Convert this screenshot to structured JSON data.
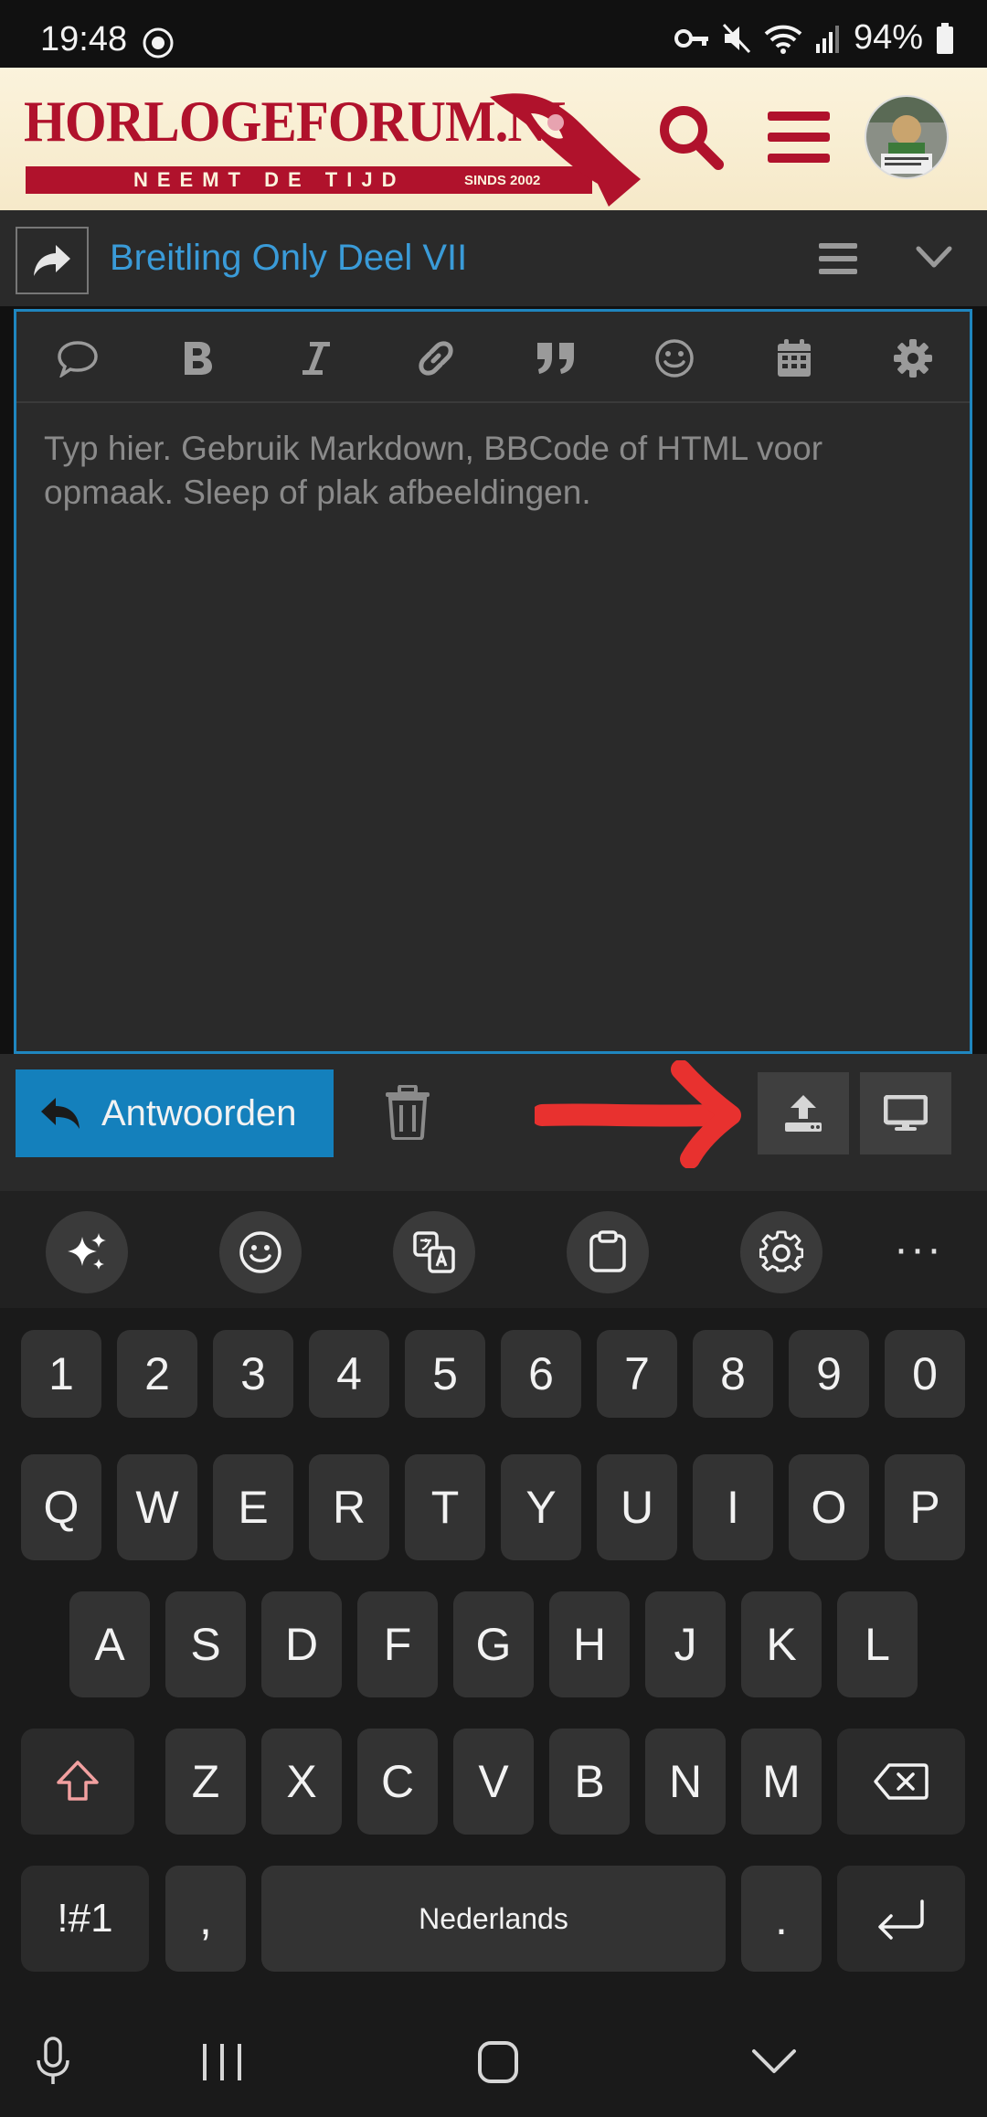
{
  "status_bar": {
    "time": "19:48",
    "battery": "94%",
    "icons": [
      "app-notification-icon",
      "vpn-key-icon",
      "mute-icon",
      "wifi-icon",
      "signal-icon",
      "battery-icon"
    ]
  },
  "header": {
    "logo_text": "HORLOGEFORUM.NL",
    "logo_tagline": "NEEMT DE TIJD",
    "logo_since": "SINDS 2002",
    "brand_color": "#b0122c",
    "icons": [
      "search-icon",
      "hamburger-menu-icon",
      "avatar"
    ]
  },
  "thread": {
    "title": "Breitling Only Deel VII"
  },
  "editor": {
    "placeholder": "Typ hier. Gebruik Markdown, BBCode of HTML voor opmaak. Sleep of plak afbeeldingen.",
    "border_color": "#1f86bf",
    "toolbar_icons": [
      "speech-bubble-icon",
      "bold-icon",
      "italic-icon",
      "link-icon",
      "quote-icon",
      "emoji-icon",
      "calendar-icon",
      "gear-icon"
    ]
  },
  "actions": {
    "reply_label": "Antwoorden",
    "accent": "#1480bc",
    "icons": [
      "reply-icon",
      "trash-icon",
      "upload-icon",
      "preview-icon"
    ]
  },
  "keyboard": {
    "toolbar_icons": [
      "sparkle-icon",
      "emoji-icon",
      "translate-icon",
      "clipboard-icon",
      "settings-icon",
      "more-icon"
    ],
    "number_row": [
      "1",
      "2",
      "3",
      "4",
      "5",
      "6",
      "7",
      "8",
      "9",
      "0"
    ],
    "row1": [
      "Q",
      "W",
      "E",
      "R",
      "T",
      "Y",
      "U",
      "I",
      "O",
      "P"
    ],
    "row2": [
      "A",
      "S",
      "D",
      "F",
      "G",
      "H",
      "J",
      "K",
      "L"
    ],
    "row3": [
      "Z",
      "X",
      "C",
      "V",
      "B",
      "N",
      "M"
    ],
    "symbols_label": "!#1",
    "comma_label": ",",
    "space_label": "Nederlands",
    "period_label": ".",
    "more_label": "···"
  },
  "nav_bar": {
    "icons": [
      "microphone-icon",
      "recents-icon",
      "home-icon",
      "hide-keyboard-icon"
    ]
  }
}
